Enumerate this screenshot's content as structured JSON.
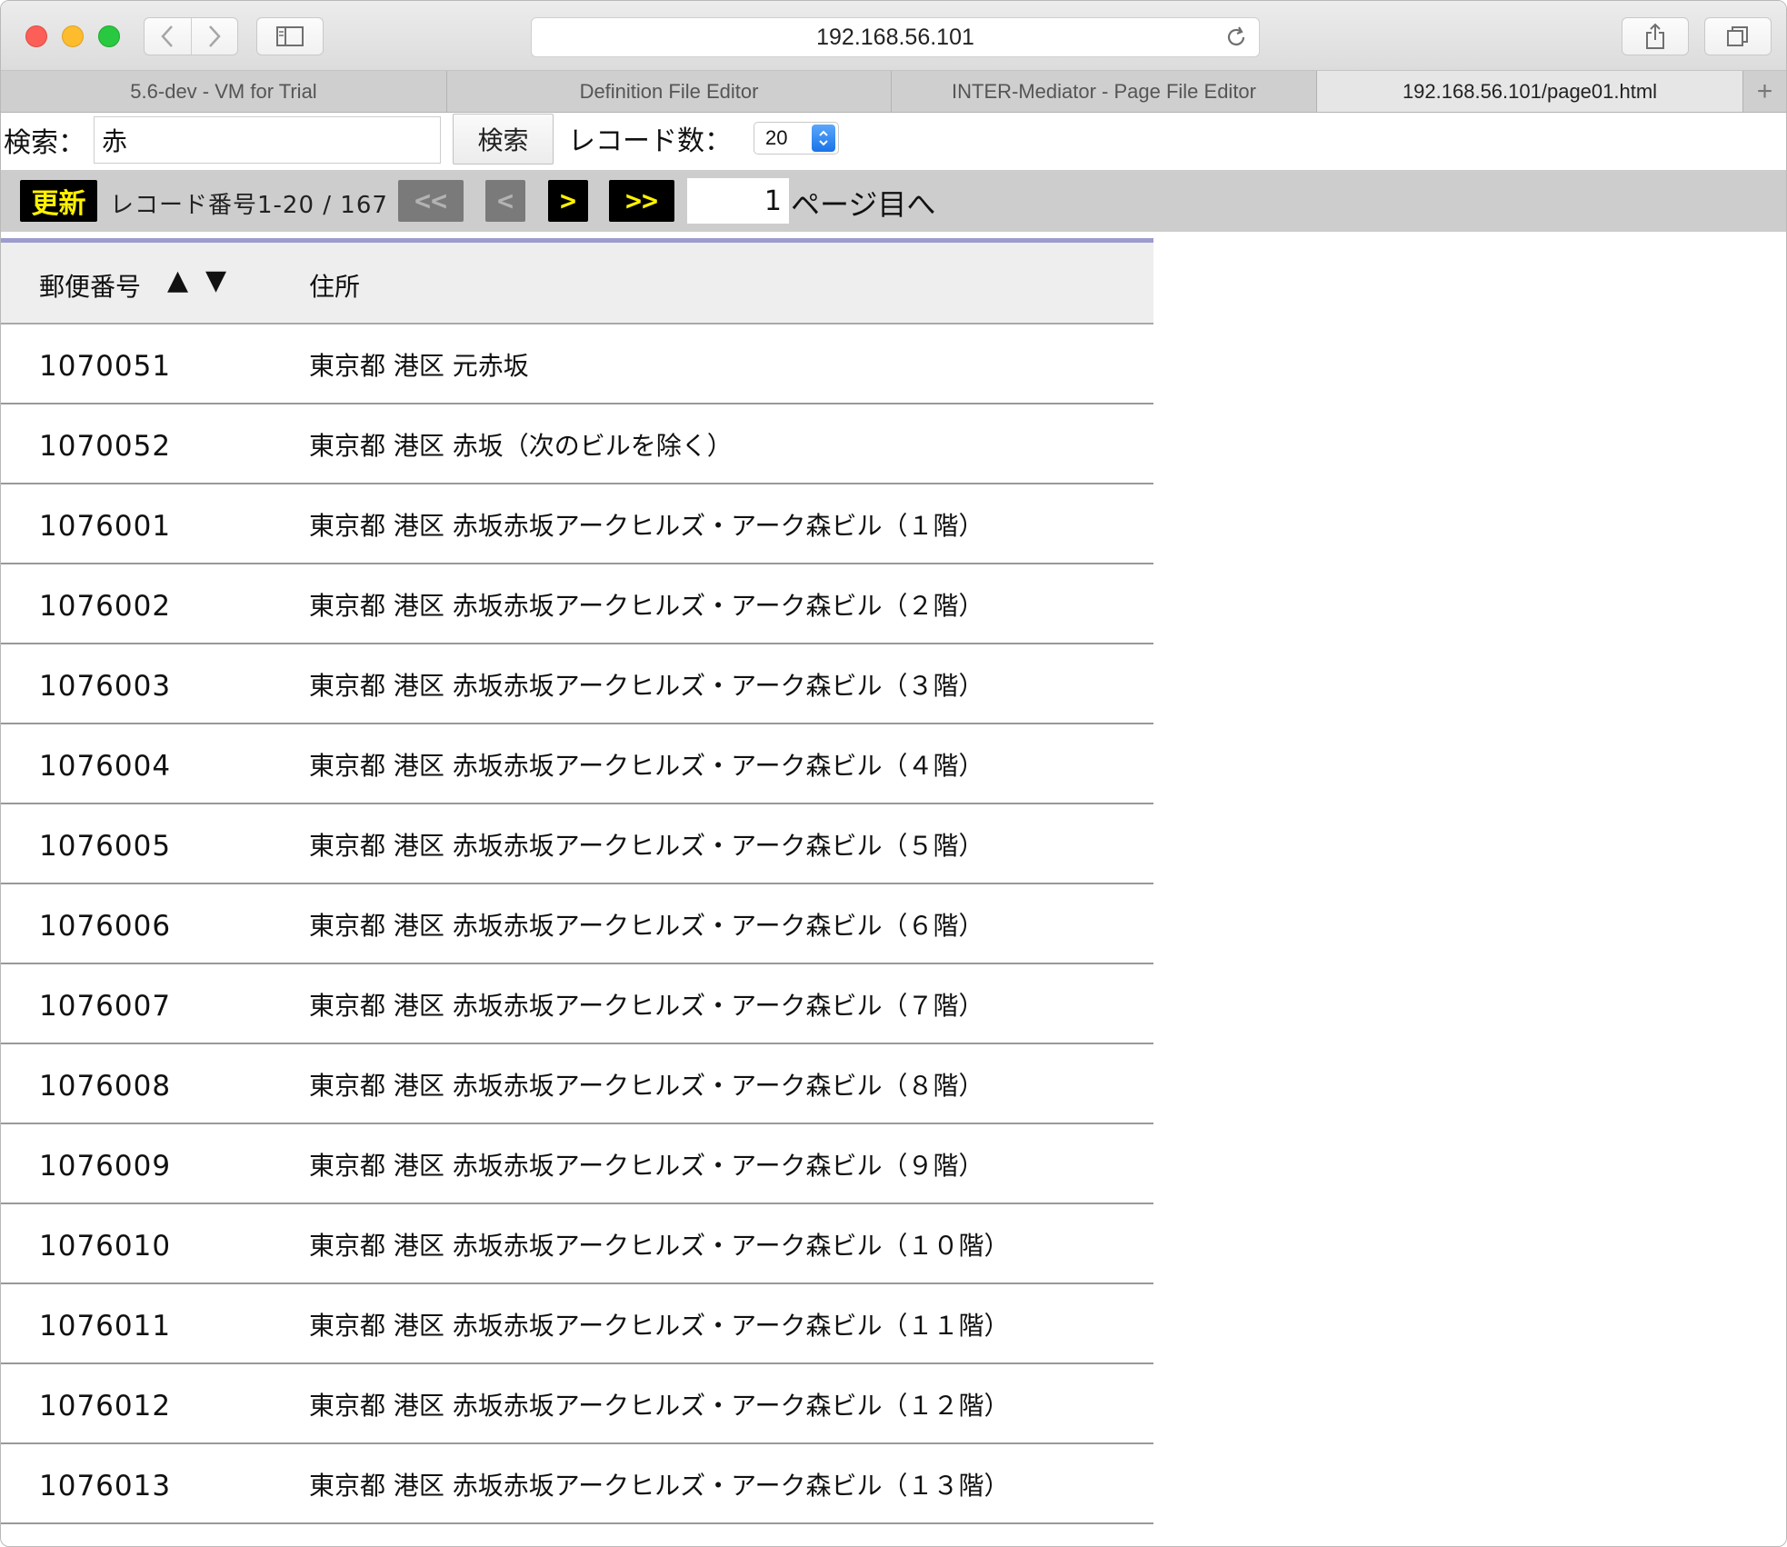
{
  "browser": {
    "url": "192.168.56.101",
    "tabs": [
      {
        "label": "5.6-dev - VM for Trial"
      },
      {
        "label": "Definition File Editor"
      },
      {
        "label": "INTER-Mediator - Page File Editor"
      },
      {
        "label": "192.168.56.101/page01.html"
      }
    ],
    "new_tab_label": "+"
  },
  "search": {
    "label": "検索：",
    "value": "赤",
    "button_label": "検索",
    "count_label": "レコード数：",
    "count_value": "20"
  },
  "navigation": {
    "update_label": "更新",
    "record_range": "レコード番号1-20 / 167",
    "first_label": "<<",
    "prev_label": "<",
    "next_label": ">",
    "last_label": ">>",
    "page_value": "1",
    "page_suffix": "ページ目へ"
  },
  "table": {
    "headers": {
      "zip": "郵便番号",
      "sort_asc": "▲",
      "sort_desc": "▼",
      "address": "住所"
    },
    "rows": [
      {
        "zip": "1070051",
        "address": "東京都 港区 元赤坂"
      },
      {
        "zip": "1070052",
        "address": "東京都 港区 赤坂（次のビルを除く）"
      },
      {
        "zip": "1076001",
        "address": "東京都 港区 赤坂赤坂アークヒルズ・アーク森ビル（１階）"
      },
      {
        "zip": "1076002",
        "address": "東京都 港区 赤坂赤坂アークヒルズ・アーク森ビル（２階）"
      },
      {
        "zip": "1076003",
        "address": "東京都 港区 赤坂赤坂アークヒルズ・アーク森ビル（３階）"
      },
      {
        "zip": "1076004",
        "address": "東京都 港区 赤坂赤坂アークヒルズ・アーク森ビル（４階）"
      },
      {
        "zip": "1076005",
        "address": "東京都 港区 赤坂赤坂アークヒルズ・アーク森ビル（５階）"
      },
      {
        "zip": "1076006",
        "address": "東京都 港区 赤坂赤坂アークヒルズ・アーク森ビル（６階）"
      },
      {
        "zip": "1076007",
        "address": "東京都 港区 赤坂赤坂アークヒルズ・アーク森ビル（７階）"
      },
      {
        "zip": "1076008",
        "address": "東京都 港区 赤坂赤坂アークヒルズ・アーク森ビル（８階）"
      },
      {
        "zip": "1076009",
        "address": "東京都 港区 赤坂赤坂アークヒルズ・アーク森ビル（９階）"
      },
      {
        "zip": "1076010",
        "address": "東京都 港区 赤坂赤坂アークヒルズ・アーク森ビル（１０階）"
      },
      {
        "zip": "1076011",
        "address": "東京都 港区 赤坂赤坂アークヒルズ・アーク森ビル（１１階）"
      },
      {
        "zip": "1076012",
        "address": "東京都 港区 赤坂赤坂アークヒルズ・アーク森ビル（１２階）"
      },
      {
        "zip": "1076013",
        "address": "東京都 港区 赤坂赤坂アークヒルズ・アーク森ビル（１３階）"
      }
    ]
  },
  "icons": [
    "back-icon",
    "forward-icon",
    "sidebar-icon",
    "reload-icon",
    "share-icon",
    "tabs-overview-icon",
    "stepper-icon"
  ],
  "colors": {
    "accent_yellow": "#fff200",
    "header_border": "#9c9ccf",
    "nav_bar": "#cdcdcd"
  }
}
